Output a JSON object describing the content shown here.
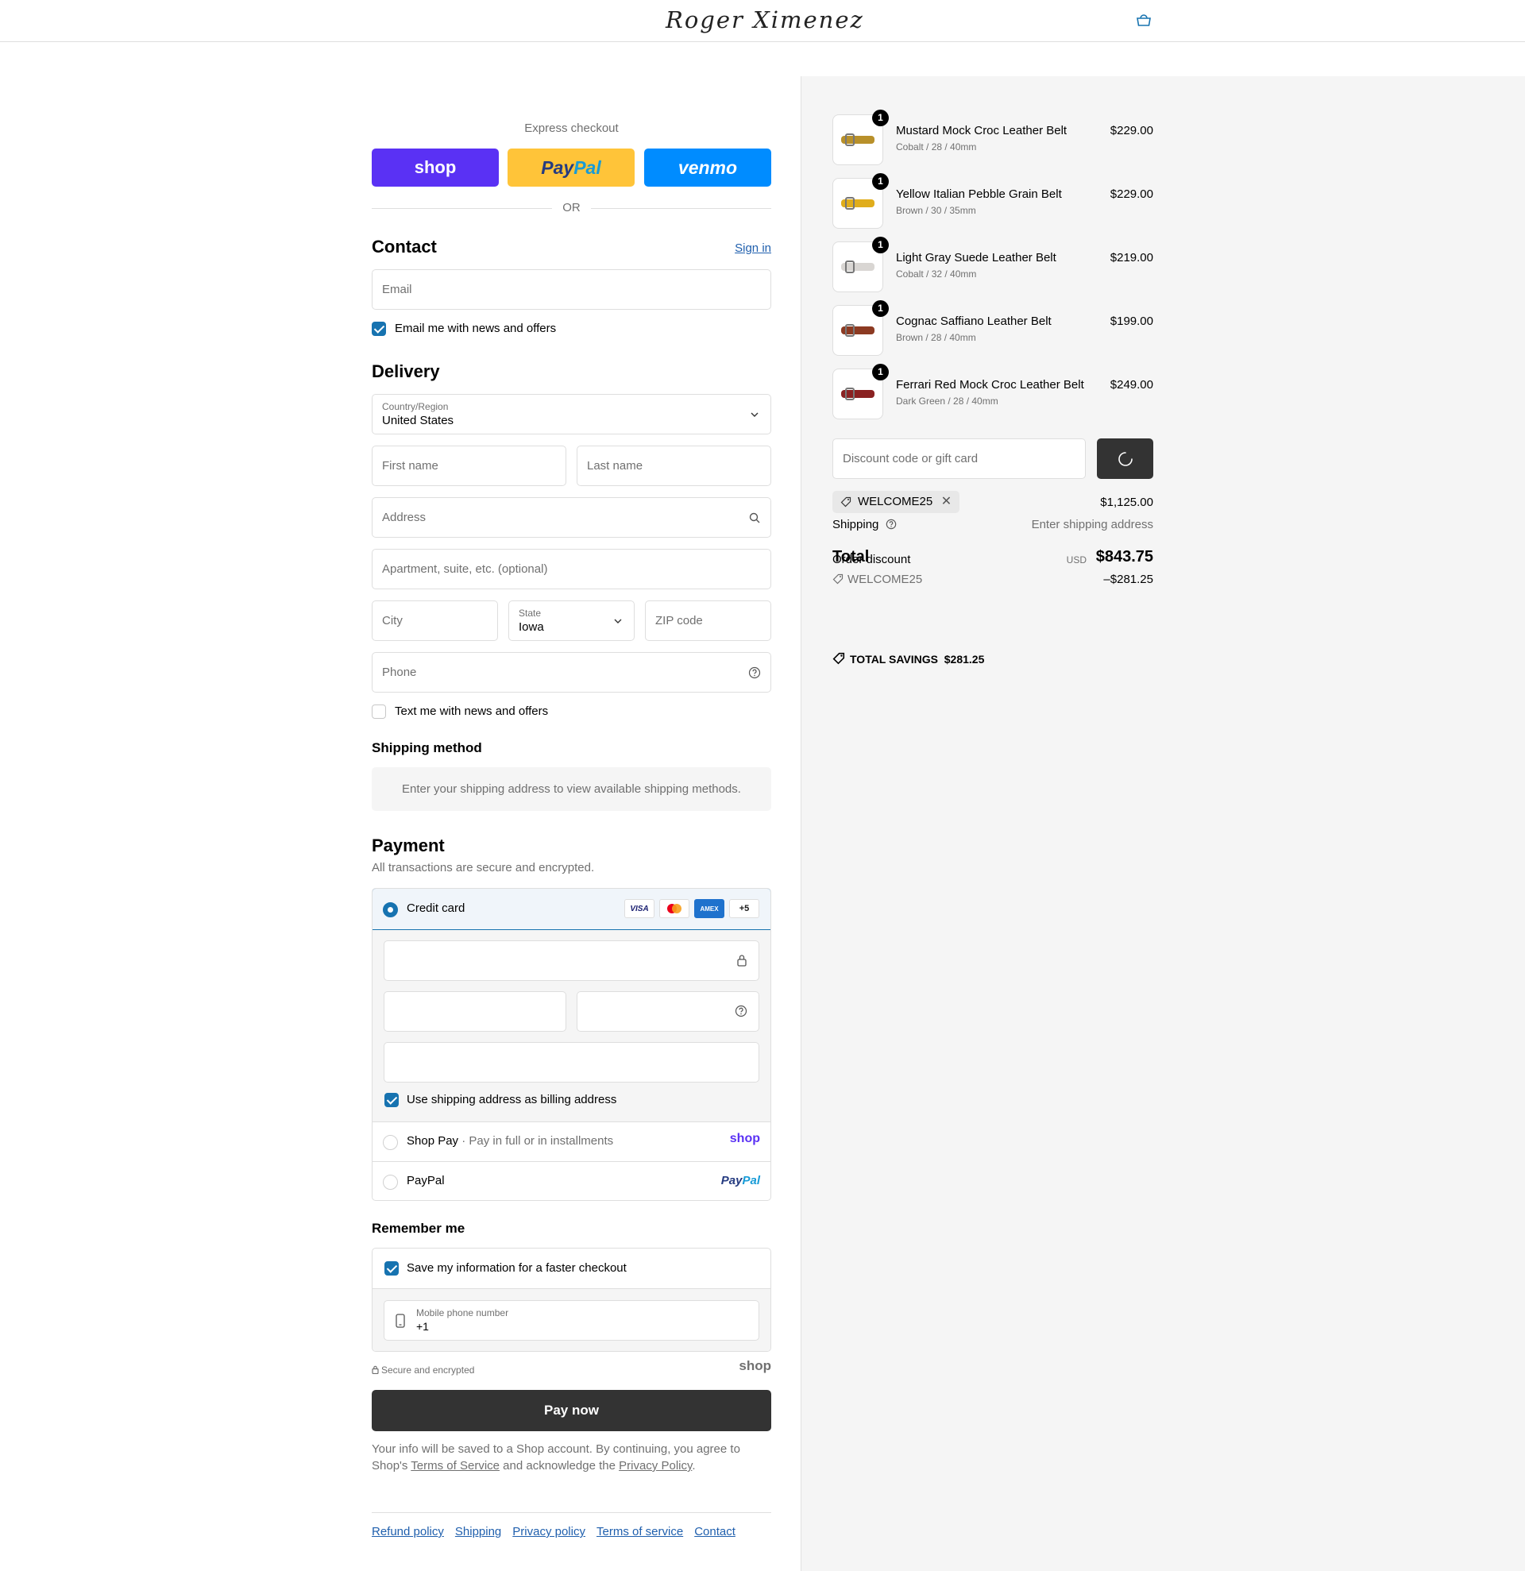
{
  "header": {
    "brand": "Roger Ximenez",
    "cart_icon": "shopping-bag-icon"
  },
  "express": {
    "title": "Express checkout",
    "shop_label": "shop",
    "paypal_label_1": "Pay",
    "paypal_label_2": "Pal",
    "venmo_label": "venmo",
    "or": "OR"
  },
  "contact": {
    "heading": "Contact",
    "sign_in": "Sign in",
    "email_placeholder": "Email",
    "email_optin": "Email me with news and offers",
    "email_optin_checked": true
  },
  "delivery": {
    "heading": "Delivery",
    "country_label": "Country/Region",
    "country_value": "United States",
    "first_name": "First name",
    "last_name": "Last name",
    "address": "Address",
    "apartment": "Apartment, suite, etc. (optional)",
    "city": "City",
    "state_label": "State",
    "state_value": "Iowa",
    "zip": "ZIP code",
    "phone": "Phone",
    "sms_optin": "Text me with news and offers",
    "sms_optin_checked": false
  },
  "shipping_method": {
    "heading": "Shipping method",
    "info": "Enter your shipping address to view available shipping methods."
  },
  "payment": {
    "heading": "Payment",
    "subtitle": "All transactions are secure and encrypted.",
    "credit_card": "Credit card",
    "card_logos": [
      "VISA",
      "",
      "AMEX",
      "+5"
    ],
    "billing_same": "Use shipping address as billing address",
    "shop_pay": "Shop Pay",
    "shop_pay_sub": "· Pay in full or in installments",
    "shop_logo": "shop",
    "paypal": "PayPal",
    "paypal_logo_1": "Pay",
    "paypal_logo_2": "Pal"
  },
  "remember": {
    "heading": "Remember me",
    "save_info": "Save my information for a faster checkout",
    "phone_label": "Mobile phone number",
    "phone_value": "+1",
    "secure": "Secure and encrypted",
    "shop_logo": "shop"
  },
  "pay_now": "Pay now",
  "legal": {
    "text_1": "Your info will be saved to a Shop account. By continuing, you agree to Shop's ",
    "terms": "Terms of Service",
    "text_2": " and acknowledge the ",
    "privacy": "Privacy Policy",
    "text_3": "."
  },
  "footer": {
    "links": [
      "Refund policy",
      "Shipping",
      "Privacy policy",
      "Terms of service",
      "Contact"
    ]
  },
  "summary": {
    "items": [
      {
        "name": "Mustard Mock Croc Leather Belt",
        "variant": "Cobalt / 28 / 40mm",
        "price": "$229.00",
        "qty": "1",
        "color": "#b8902a"
      },
      {
        "name": "Yellow Italian Pebble Grain Belt",
        "variant": "Brown / 30 / 35mm",
        "price": "$229.00",
        "qty": "1",
        "color": "#e0ad1c"
      },
      {
        "name": "Light Gray Suede Leather Belt",
        "variant": "Cobalt / 32 / 40mm",
        "price": "$219.00",
        "qty": "1",
        "color": "#d9d6d3"
      },
      {
        "name": "Cognac Saffiano Leather Belt",
        "variant": "Brown / 28 / 40mm",
        "price": "$199.00",
        "qty": "1",
        "color": "#8c3a22"
      },
      {
        "name": "Ferrari Red Mock Croc Leather Belt",
        "variant": "Dark Green / 28 / 40mm",
        "price": "$249.00",
        "qty": "1",
        "color": "#8a2222"
      }
    ],
    "discount_placeholder": "Discount code or gift card",
    "applied_code": "WELCOME25",
    "subtotal": "$1,125.00",
    "shipping_label": "Shipping",
    "shipping_value": "Enter shipping address",
    "total_label": "Total",
    "order_discount_label": "Order discount",
    "currency": "USD",
    "total_value": "$843.75",
    "discount_code": "WELCOME25",
    "discount_value": "–$281.25",
    "savings_label": "TOTAL SAVINGS",
    "savings_value": "$281.25"
  },
  "colors": {
    "accent": "#1773b0",
    "shop_purple": "#5a31f4",
    "paypal_yellow": "#ffc439",
    "venmo_blue": "#008cff",
    "button_dark": "#333333"
  }
}
